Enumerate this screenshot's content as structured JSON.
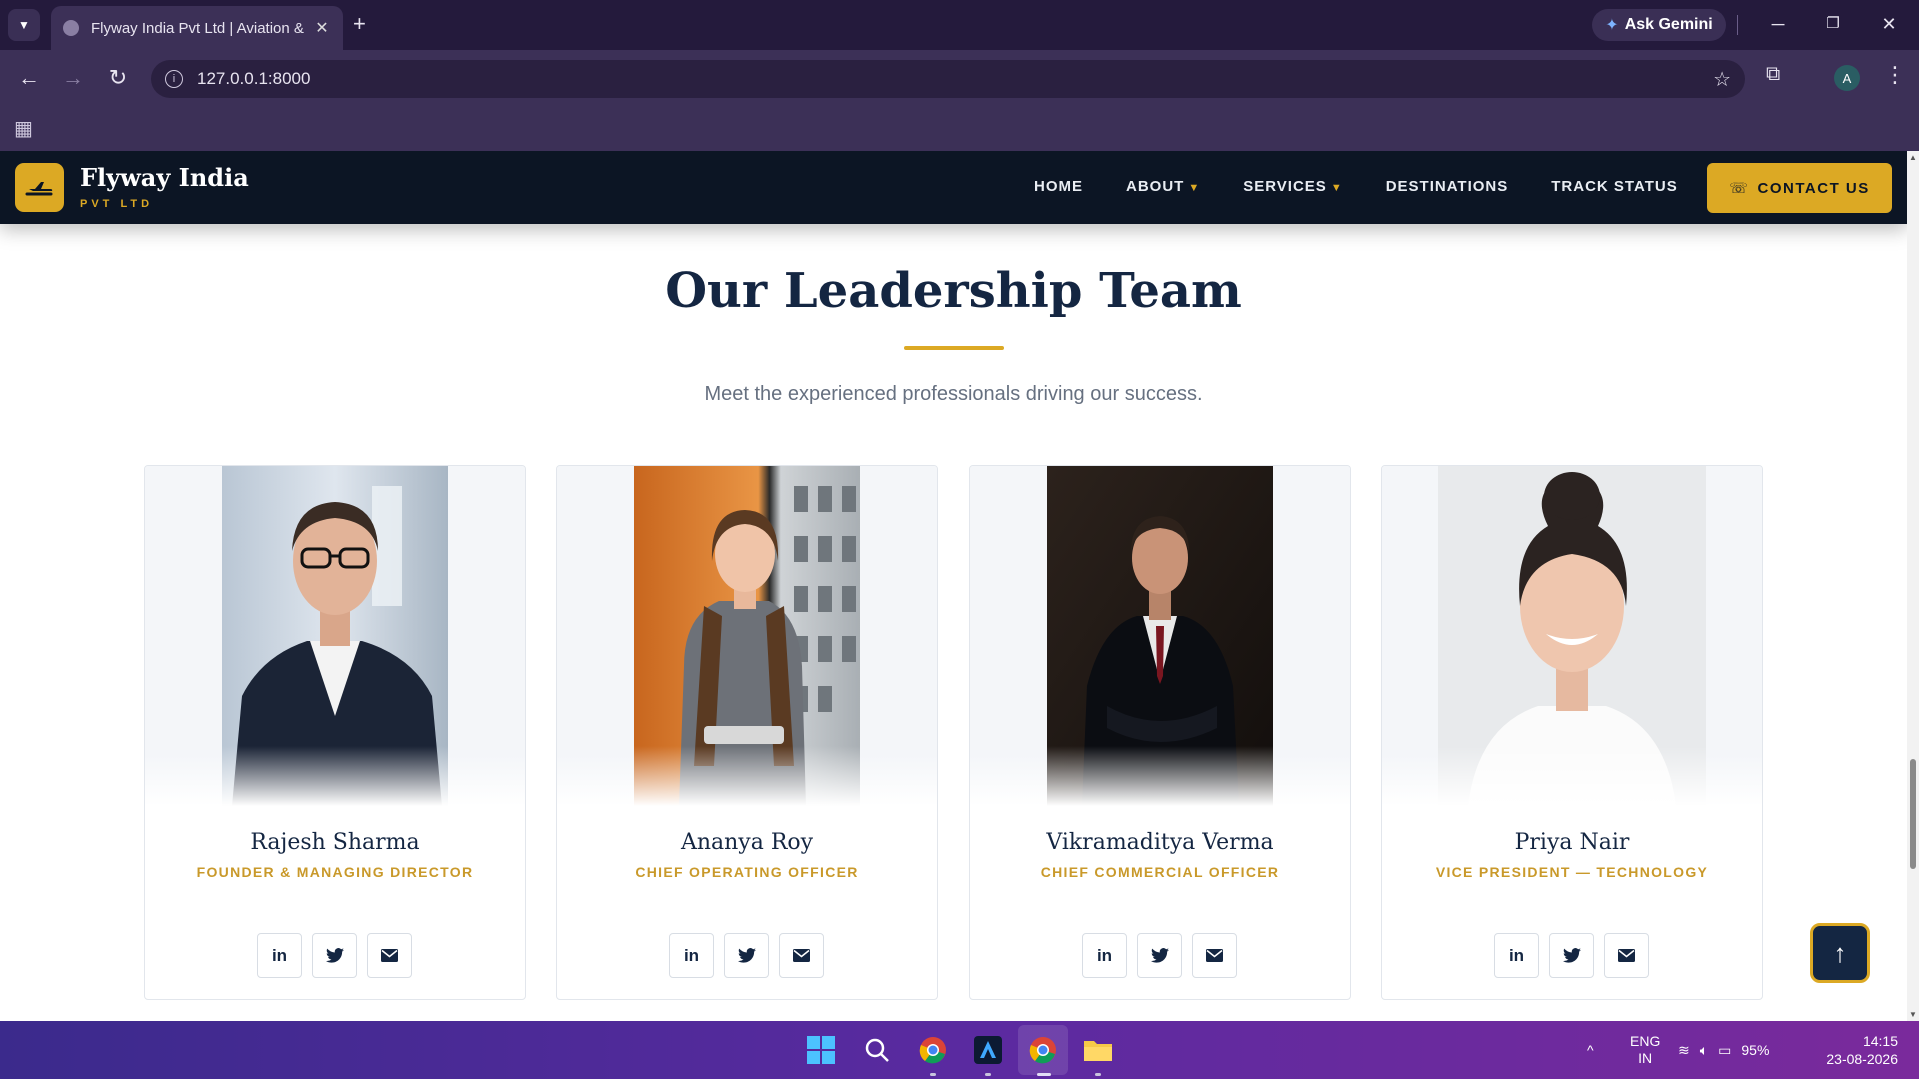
{
  "browser": {
    "tab_title": "Flyway India Pvt Ltd | Aviation &",
    "tab_close": "✕",
    "new_tab": "+",
    "gemini_label": "Ask Gemini",
    "url": "127.0.0.1:8000",
    "profile_initial": "A"
  },
  "site": {
    "brand": "Flyway India",
    "brand_sub": "PVT LTD",
    "nav": {
      "home": "HOME",
      "about": "ABOUT",
      "services": "SERVICES",
      "destinations": "DESTINATIONS",
      "track": "TRACK STATUS"
    },
    "contact_label": "CONTACT US",
    "accent": "#dca924",
    "navy": "#142642"
  },
  "section": {
    "heading": "Our Leadership Team",
    "subtitle": "Meet the experienced professionals driving our success."
  },
  "team": [
    {
      "name": "Rajesh Sharma",
      "role": "FOUNDER & MANAGING DIRECTOR"
    },
    {
      "name": "Ananya Roy",
      "role": "CHIEF OPERATING OFFICER"
    },
    {
      "name": "Vikramaditya Verma",
      "role": "CHIEF COMMERCIAL OFFICER"
    },
    {
      "name": "Priya Nair",
      "role": "VICE PRESIDENT — TECHNOLOGY"
    }
  ],
  "social_icons": {
    "linkedin": "in",
    "twitter": "linkedin-twitter-icon",
    "email": "email-icon"
  },
  "taskbar": {
    "lang_line1": "ENG",
    "lang_line2": "IN",
    "battery": "95%",
    "time": "14:15",
    "date": "23-08-2026"
  }
}
